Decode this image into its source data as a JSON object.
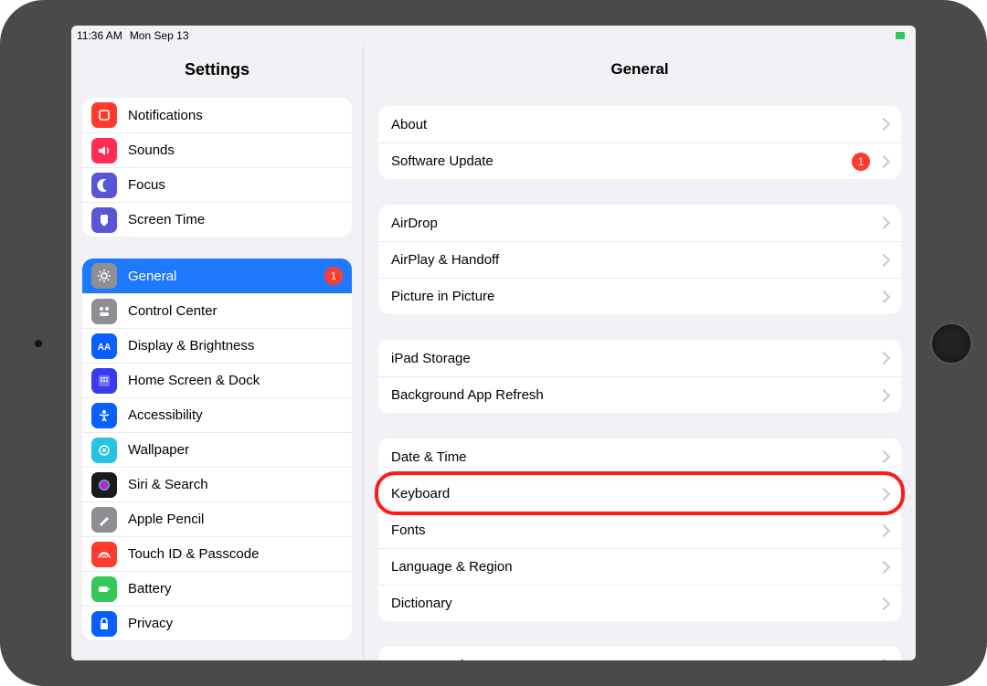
{
  "status": {
    "time": "11:36 AM",
    "date": "Mon Sep 13"
  },
  "sidebar": {
    "title": "Settings",
    "groups": [
      {
        "rows": [
          {
            "id": "notifications",
            "label": "Notifications",
            "icon": "notifications",
            "icon_bg": "#ff3b30"
          },
          {
            "id": "sounds",
            "label": "Sounds",
            "icon": "sounds",
            "icon_bg": "#ff2d55"
          },
          {
            "id": "focus",
            "label": "Focus",
            "icon": "focus",
            "icon_bg": "#5856d6"
          },
          {
            "id": "screentime",
            "label": "Screen Time",
            "icon": "screentime",
            "icon_bg": "#5856d6"
          }
        ]
      },
      {
        "rows": [
          {
            "id": "general",
            "label": "General",
            "icon": "general",
            "icon_bg": "#8e8e93",
            "selected": true,
            "badge": "1"
          },
          {
            "id": "controlcenter",
            "label": "Control Center",
            "icon": "controlcenter",
            "icon_bg": "#8e8e93"
          },
          {
            "id": "display",
            "label": "Display & Brightness",
            "icon": "display",
            "icon_bg": "#0a60ff"
          },
          {
            "id": "homescreen",
            "label": "Home Screen & Dock",
            "icon": "homescreen",
            "icon_bg": "#3a3af0"
          },
          {
            "id": "accessibility",
            "label": "Accessibility",
            "icon": "accessibility",
            "icon_bg": "#0a60ff"
          },
          {
            "id": "wallpaper",
            "label": "Wallpaper",
            "icon": "wallpaper",
            "icon_bg": "#27c3e1"
          },
          {
            "id": "siri",
            "label": "Siri & Search",
            "icon": "siri",
            "icon_bg": "#1a1a1a"
          },
          {
            "id": "applepencil",
            "label": "Apple Pencil",
            "icon": "applepencil",
            "icon_bg": "#8e8e93"
          },
          {
            "id": "touchid",
            "label": "Touch ID & Passcode",
            "icon": "touchid",
            "icon_bg": "#ff3b30"
          },
          {
            "id": "battery",
            "label": "Battery",
            "icon": "battery",
            "icon_bg": "#34c759"
          },
          {
            "id": "privacy",
            "label": "Privacy",
            "icon": "privacy",
            "icon_bg": "#0a60ff"
          }
        ]
      }
    ]
  },
  "detail": {
    "title": "General",
    "groups": [
      {
        "rows": [
          {
            "id": "about",
            "label": "About"
          },
          {
            "id": "softwareupdate",
            "label": "Software Update",
            "badge": "1"
          }
        ]
      },
      {
        "rows": [
          {
            "id": "airdrop",
            "label": "AirDrop"
          },
          {
            "id": "airplay",
            "label": "AirPlay & Handoff"
          },
          {
            "id": "pip",
            "label": "Picture in Picture"
          }
        ]
      },
      {
        "rows": [
          {
            "id": "storage",
            "label": "iPad Storage"
          },
          {
            "id": "bgappr",
            "label": "Background App Refresh"
          }
        ]
      },
      {
        "rows": [
          {
            "id": "datetime",
            "label": "Date & Time"
          },
          {
            "id": "keyboard",
            "label": "Keyboard",
            "highlighted": true
          },
          {
            "id": "fonts",
            "label": "Fonts"
          },
          {
            "id": "langregion",
            "label": "Language & Region"
          },
          {
            "id": "dictionary",
            "label": "Dictionary"
          }
        ]
      },
      {
        "rows": [
          {
            "id": "vpn",
            "label": "VPN & Device Management"
          }
        ]
      }
    ]
  }
}
